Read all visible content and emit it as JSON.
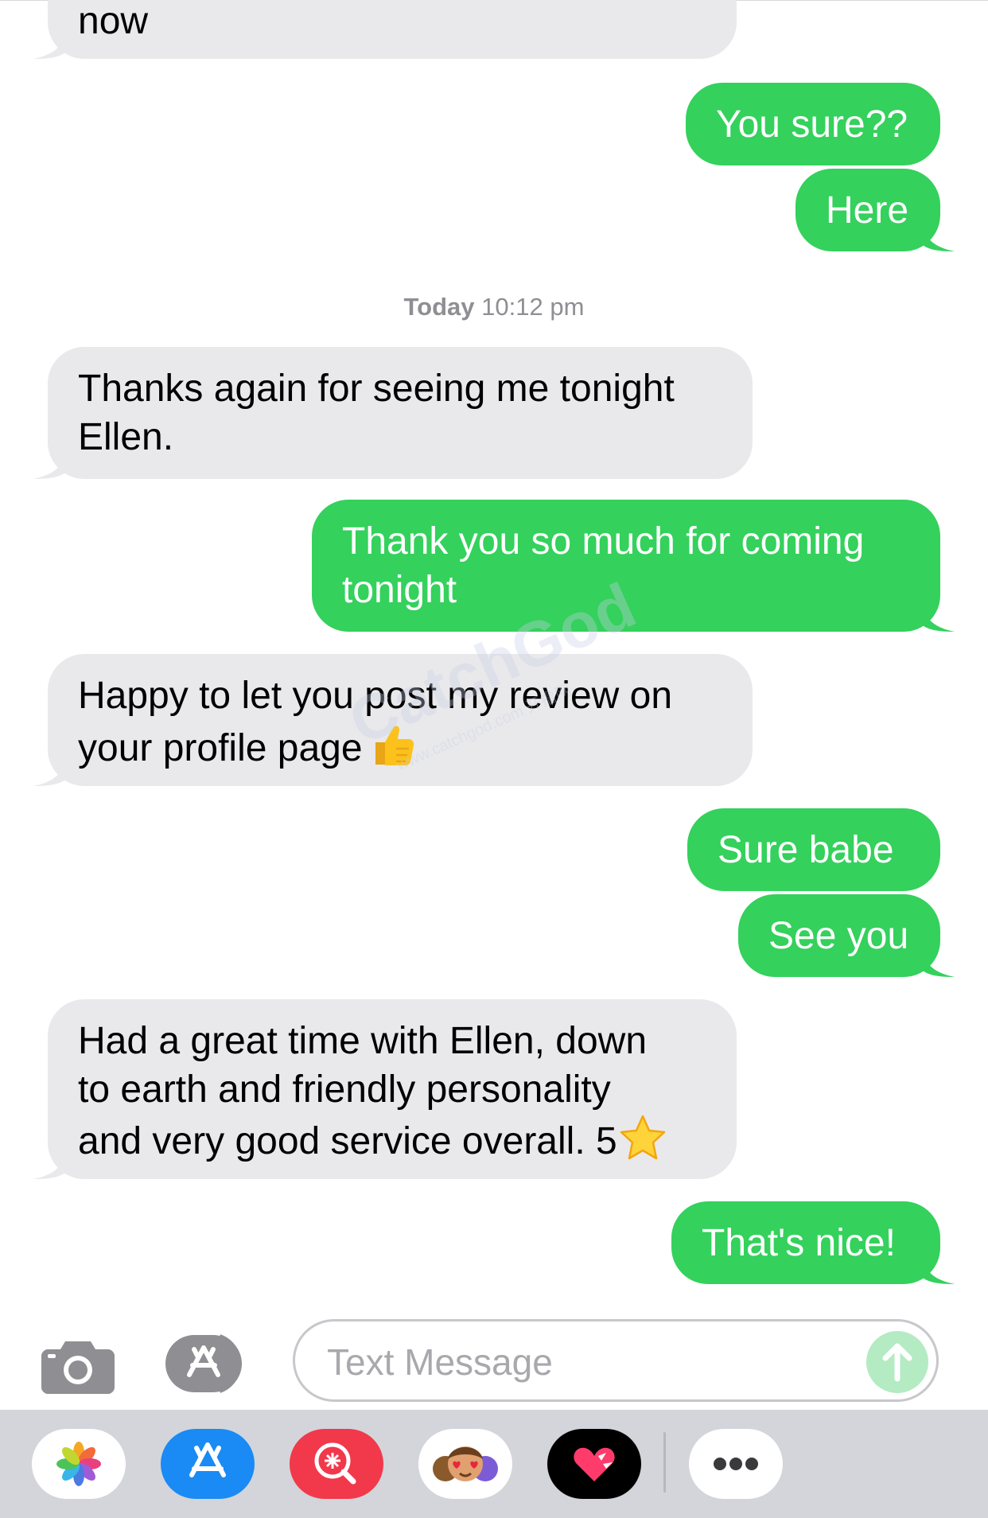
{
  "messages": [
    {
      "dir": "in",
      "text": "now"
    },
    {
      "dir": "out",
      "text": "You sure??"
    },
    {
      "dir": "out",
      "text": "Here"
    },
    {
      "dir": "in",
      "text": "Thanks again for seeing me tonight\nEllen."
    },
    {
      "dir": "out",
      "text": "Thank you so much for coming\ntonight"
    },
    {
      "dir": "in",
      "text": "Happy to let you post my review on\nyour profile page",
      "emoji": "thumbs-up"
    },
    {
      "dir": "out",
      "text": "Sure babe"
    },
    {
      "dir": "out",
      "text": "See you"
    },
    {
      "dir": "in",
      "text": "Had a great time with Ellen, down\nto earth and friendly personality\nand very good service overall. 5",
      "emoji": "star"
    },
    {
      "dir": "out",
      "text": "That's nice!"
    }
  ],
  "timestamp": {
    "day": "Today",
    "time": "10:12 pm"
  },
  "composer": {
    "placeholder": "Text Message"
  },
  "watermark": {
    "brand": "CatchGod",
    "url": "www.catchgod.com 开撸网"
  },
  "drawer_apps": [
    "photos-icon",
    "app-store-icon",
    "image-search-icon",
    "memoji-stickers-icon",
    "digital-touch-icon",
    "more-icon"
  ],
  "colors": {
    "outgoing": "#34d15c",
    "incoming": "#e9e9eb",
    "timestamp": "#8e8e93",
    "drawer": "#d3d5da"
  }
}
